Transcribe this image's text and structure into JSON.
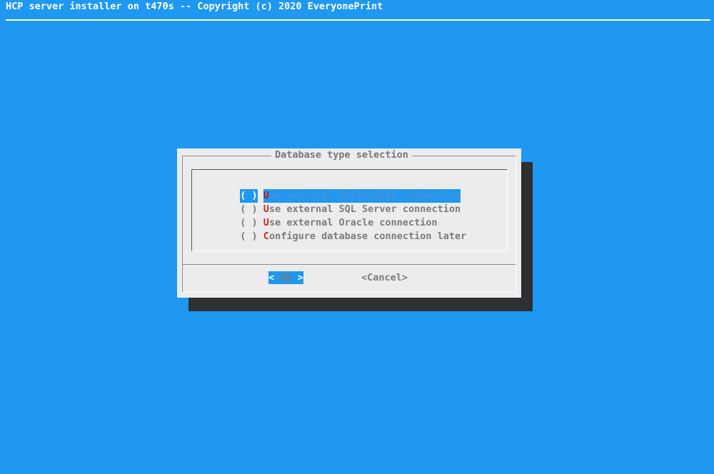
{
  "backtitle": "HCP server installer on t470s -- Copyright (c) 2020 EveryonePrint",
  "dialog": {
    "title": "Database type selection",
    "options": [
      {
        "mark": "( )",
        "hotkey": "U",
        "rest": "se external PostgreSQL connection",
        "selected": true
      },
      {
        "mark": "( )",
        "hotkey": "U",
        "rest": "se external SQL Server connection",
        "selected": false
      },
      {
        "mark": "( )",
        "hotkey": "U",
        "rest": "se external Oracle connection",
        "selected": false
      },
      {
        "mark": "( )",
        "hotkey": "C",
        "rest": "onfigure database connection later",
        "selected": false
      }
    ],
    "buttons": {
      "ok_left": "< ",
      "ok_hot": "OK",
      "ok_right": " >",
      "cancel": "<Cancel>"
    }
  },
  "colors": {
    "background": "#1e98f0",
    "dialog": "#ececec",
    "shadow": "#2e2f31",
    "hotkey": "#d42828"
  }
}
